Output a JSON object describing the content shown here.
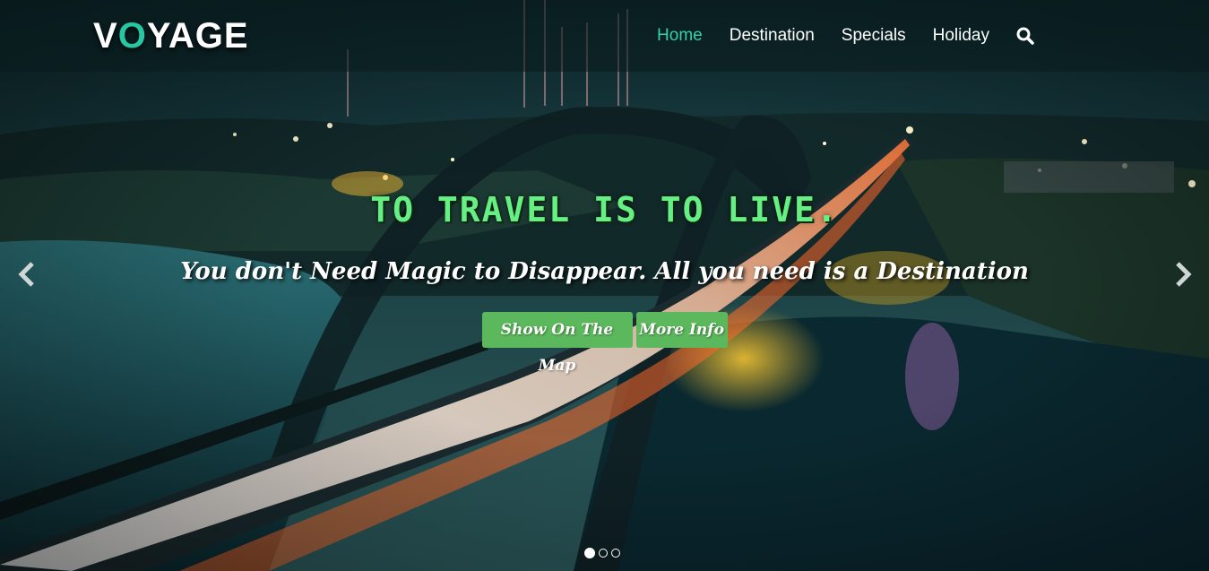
{
  "brand": {
    "logo_prefix": "V",
    "logo_accent": "O",
    "logo_suffix": "YAGE"
  },
  "nav": {
    "items": [
      {
        "label": "Home",
        "active": true
      },
      {
        "label": "Destination",
        "active": false
      },
      {
        "label": "Specials",
        "active": false
      },
      {
        "label": "Holiday",
        "active": false
      }
    ],
    "search_icon": "search-icon"
  },
  "slide": {
    "headline": "TO TRAVEL IS TO LIVE.",
    "tagline": "You don't Need Magic to Disappear. All you need is a Destination",
    "primary_button": "Show On The Map",
    "secondary_button": "More Info"
  },
  "carousel": {
    "prev_icon": "chevron-left-icon",
    "next_icon": "chevron-right-icon",
    "active_slide": 1,
    "slide_count": 3
  },
  "colors": {
    "accent": "#35d1a8",
    "headline": "#66ef82",
    "button": "#5cb85c"
  }
}
